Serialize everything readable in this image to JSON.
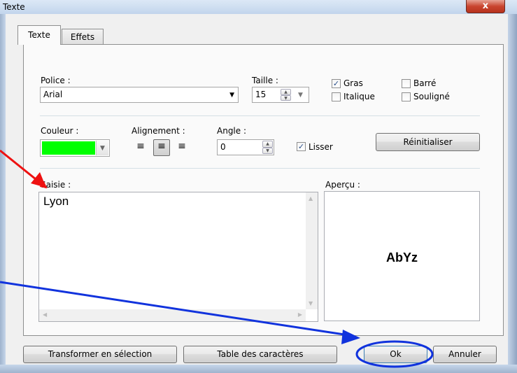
{
  "window": {
    "title": "Texte",
    "close_label": "x"
  },
  "tabs": [
    {
      "label": "Texte",
      "active": true
    },
    {
      "label": "Effets",
      "active": false
    }
  ],
  "font": {
    "police_label": "Police :",
    "police_value": "Arial",
    "taille_label": "Taille :",
    "taille_value": "15",
    "gras_label": "Gras",
    "gras_checked": true,
    "italique_label": "Italique",
    "italique_checked": false,
    "barre_label": "Barré",
    "barre_checked": false,
    "souligne_label": "Souligné",
    "souligne_checked": false
  },
  "style": {
    "couleur_label": "Couleur :",
    "couleur_value": "#00ff00",
    "alignement_label": "Alignement :",
    "alignement_selected": "center",
    "angle_label": "Angle :",
    "angle_value": "0",
    "lisser_label": "Lisser",
    "lisser_checked": true,
    "reset_label": "Réinitialiser"
  },
  "saisie": {
    "label": "Saisie :",
    "text": "Lyon"
  },
  "apercu": {
    "label": "Aperçu :",
    "sample": "AbYz"
  },
  "buttons": {
    "transformer": "Transformer en sélection",
    "table": "Table des caractères",
    "ok": "Ok",
    "annuler": "Annuler"
  },
  "icons": {
    "check": "✓",
    "dropdown": "chevron-down-icon",
    "spin_up": "▲",
    "spin_down": "▼"
  },
  "annotation_colors": {
    "red": "#ee1111",
    "blue": "#1133dd"
  }
}
